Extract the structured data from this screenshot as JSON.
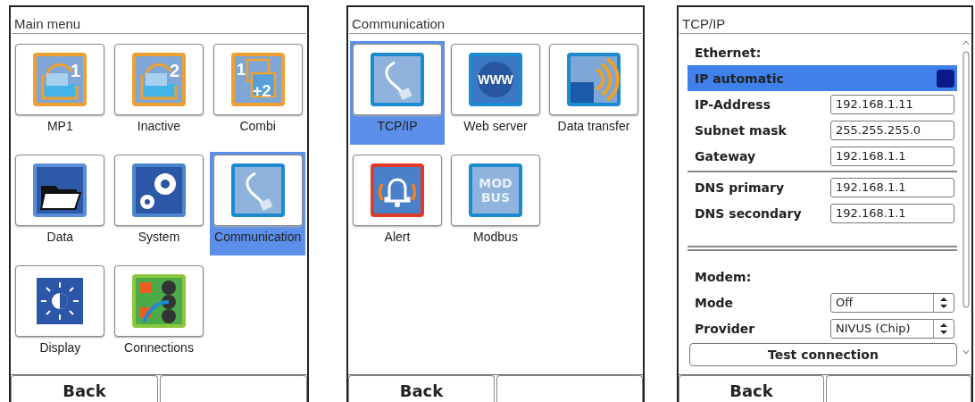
{
  "screens": [
    {
      "kind": "menu",
      "title": "Main menu",
      "soft_keys": [
        "Back"
      ],
      "items": [
        {
          "label": "MP1",
          "kind": "mp",
          "icon_text": [
            "1"
          ],
          "selected": false
        },
        {
          "label": "Inactive",
          "kind": "mp",
          "icon_text": [
            "2"
          ],
          "selected": false
        },
        {
          "label": "Combi",
          "kind": "combi",
          "icon_text": [
            "1",
            "+2"
          ],
          "selected": false
        },
        {
          "label": "Data",
          "kind": "data",
          "selected": false
        },
        {
          "label": "System",
          "kind": "system",
          "selected": false
        },
        {
          "label": "Communication",
          "kind": "cable",
          "selected": true
        },
        {
          "label": "Display",
          "kind": "display",
          "selected": false
        },
        {
          "label": "Connections",
          "kind": "connections",
          "selected": false
        }
      ]
    },
    {
      "kind": "menu",
      "title": "Communication",
      "soft_keys": [
        "Back"
      ],
      "items": [
        {
          "label": "TCP/IP",
          "kind": "cable",
          "selected": true
        },
        {
          "label": "Web server",
          "kind": "globe",
          "icon_text": [
            "WWW"
          ],
          "selected": false
        },
        {
          "label": "Data transfer",
          "kind": "transfer",
          "selected": false
        },
        {
          "label": "Alert",
          "kind": "bell",
          "selected": false
        },
        {
          "label": "Modbus",
          "kind": "plate",
          "icon_text": [
            "MOD",
            "BUS"
          ],
          "selected": false
        }
      ]
    },
    {
      "kind": "settings",
      "title": "TCP/IP",
      "soft_keys": [
        "Back"
      ],
      "rows": [
        {
          "kind": "section",
          "label": "Ethernet:"
        },
        {
          "kind": "toggle",
          "label": "IP automatic",
          "on": true,
          "selected": true
        },
        {
          "kind": "field",
          "label": "IP-Address",
          "value": "192.168.1.11"
        },
        {
          "kind": "field",
          "label": "Subnet mask",
          "value": "255.255.255.0"
        },
        {
          "kind": "field",
          "label": "Gateway",
          "value": "192.168.1.1"
        },
        {
          "kind": "divider"
        },
        {
          "kind": "field",
          "label": "DNS primary",
          "value": "192.168.1.1"
        },
        {
          "kind": "field",
          "label": "DNS secondary",
          "value": "192.168.1.1"
        },
        {
          "kind": "double-divider"
        },
        {
          "kind": "section",
          "label": "Modem:"
        },
        {
          "kind": "select",
          "label": "Mode",
          "value": "Off"
        },
        {
          "kind": "select",
          "label": "Provider",
          "value": "NIVUS (Chip)"
        },
        {
          "kind": "button",
          "label": "Test connection"
        }
      ]
    }
  ]
}
